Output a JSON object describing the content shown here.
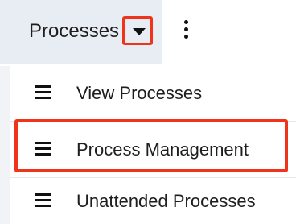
{
  "nav": {
    "tab_label": "Processes",
    "caret_icon": "caret-down-icon",
    "more_icon": "vertical-ellipsis-icon"
  },
  "menu": {
    "items": [
      {
        "label": "View Processes",
        "icon": "menu-lines-icon"
      },
      {
        "label": "Process Management",
        "icon": "menu-lines-icon",
        "highlighted": true
      },
      {
        "label": "Unattended Processes",
        "icon": "menu-lines-icon"
      }
    ]
  },
  "colors": {
    "highlight": "#f0341c",
    "tab_background": "#e8edf4"
  }
}
